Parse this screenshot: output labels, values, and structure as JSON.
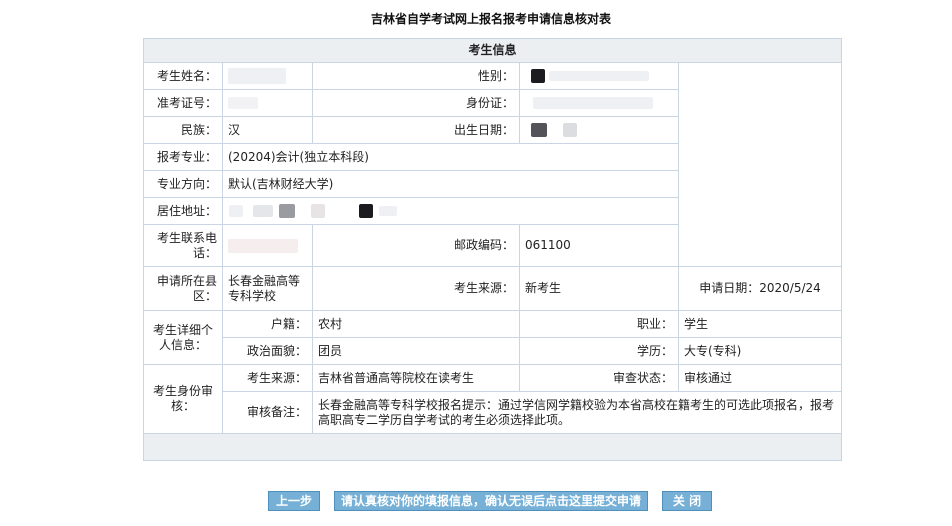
{
  "page_title": "吉林省自学考试网上报名报考申请信息核对表",
  "section_title": "考生信息",
  "labels": {
    "name": "考生姓名：",
    "gender": "性别：",
    "admission_no": "准考证号：",
    "id_card": "身份证：",
    "ethnicity": "民族：",
    "birth_date": "出生日期：",
    "major": "报考专业：",
    "direction": "专业方向：",
    "address": "居住地址：",
    "phone": "考生联系电话：",
    "postal_code": "邮政编码：",
    "county": "申请所在县区：",
    "source": "考生来源：",
    "apply_date": "申请日期：",
    "personal_info": "考生详细个人信息：",
    "household": "户籍：",
    "occupation": "职业：",
    "political": "政治面貌：",
    "education": "学历：",
    "audit": "考生身份审核：",
    "audit_source": "考生来源：",
    "audit_status": "审查状态：",
    "audit_remark": "审核备注："
  },
  "values": {
    "ethnicity": "汉",
    "major": "(20204)会计(独立本科段)",
    "direction": "默认(吉林财经大学)",
    "postal_code": "061100",
    "county": "长春金融高等专科学校",
    "source": "新考生",
    "apply_date": "2020/5/24",
    "household": "农村",
    "occupation": "学生",
    "political": "团员",
    "education": "大专(专科)",
    "audit_source": "吉林省普通高等院校在读考生",
    "audit_status": "审核通过",
    "audit_remark": "长春金融高等专科学校报名提示：通过学信网学籍校验为本省高校在籍考生的可选此项报名，报考高职高专二学历自学考试的考生必须选择此项。"
  },
  "buttons": {
    "prev": "上一步",
    "submit": "请认真核对你的填报信息，确认无误后点击这里提交申请",
    "close": "关 闭"
  }
}
